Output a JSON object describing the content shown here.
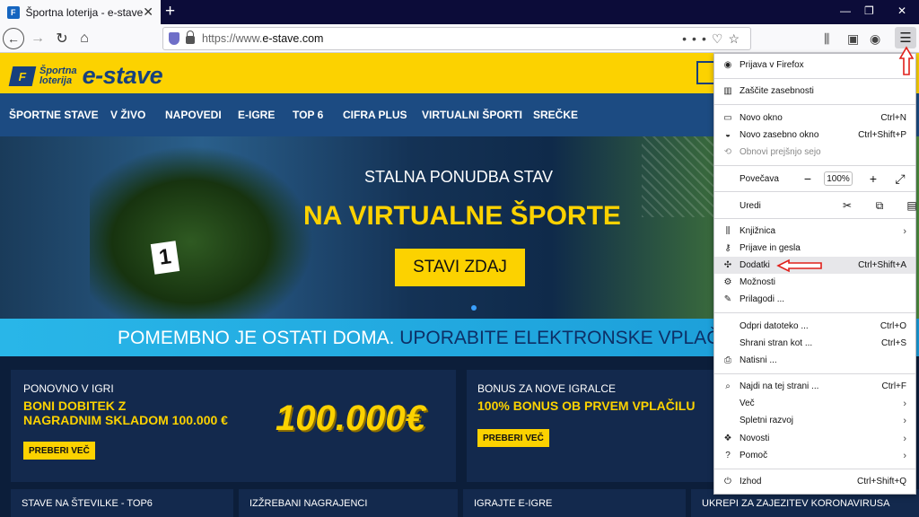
{
  "browser": {
    "tab_title": "Športna loterija - e-stave",
    "tab_favicon": "F",
    "new_tab": "+",
    "url_prefix": "https://www.",
    "url_domain": "e-stave.com",
    "win_min": "—",
    "win_max": "❐",
    "win_close": "✕"
  },
  "site": {
    "logo_small_line1": "Športna",
    "logo_small_line2": "loterija",
    "logo_big": "e-stave",
    "nav": [
      "ŠPORTNE STAVE",
      "V ŽIVO",
      "NAPOVEDI",
      "E-IGRE",
      "TOP 6",
      "CIFRA PLUS",
      "VIRTUALNI ŠPORTI",
      "SREČKE"
    ],
    "hero_sub": "STALNA PONUDBA STAV",
    "hero_title": "NA VIRTUALNE ŠPORTE",
    "hero_button": "STAVI ZDAJ",
    "hero_plate": "1",
    "banner_a": "POMEMBNO JE OSTATI DOMA.",
    "banner_b": " UPORABITE ELEKTRONSKE VPLAČI",
    "card1_kicker": "PONOVNO V IGRI",
    "card1_title_1": "BONI DOBITEK Z",
    "card1_title_2": "NAGRADNIM SKLADOM 100.000 €",
    "card1_button": "PREBERI VEČ",
    "card1_big": "100.000€",
    "card2_kicker": "BONUS ZA NOVE IGRALCE",
    "card2_title": "100% BONUS OB PRVEM VPLAČILU",
    "card2_button": "PREBERI VEČ",
    "bottom_cards": [
      "STAVE NA ŠTEVILKE - TOP6",
      "IZŽREBANI NAGRAJENCI",
      "IGRAJTE E-IGRE",
      "UKREPI ZA ZAJEZITEV KORONAVIRUSA"
    ]
  },
  "menu": {
    "sign_in": "Prijava v Firefox",
    "privacy": "Zaščite zasebnosti",
    "new_window": "Novo okno",
    "new_window_sc": "Ctrl+N",
    "private_window": "Novo zasebno okno",
    "private_window_sc": "Ctrl+Shift+P",
    "restore": "Obnovi prejšnjo sejo",
    "zoom": "Povečava",
    "zoom_minus": "−",
    "zoom_value": "100%",
    "zoom_plus": "+",
    "zoom_full": "⤢",
    "edit": "Uredi",
    "library": "Knjižnica",
    "logins": "Prijave in gesla",
    "addons": "Dodatki",
    "addons_sc": "Ctrl+Shift+A",
    "options": "Možnosti",
    "customize": "Prilagodi ...",
    "open_file": "Odpri datoteko ...",
    "open_file_sc": "Ctrl+O",
    "save_page": "Shrani stran kot ...",
    "save_page_sc": "Ctrl+S",
    "print": "Natisni ...",
    "find": "Najdi na tej strani ...",
    "find_sc": "Ctrl+F",
    "more": "Več",
    "webdev": "Spletni razvoj",
    "whatsnew": "Novosti",
    "help": "Pomoč",
    "quit": "Izhod",
    "quit_sc": "Ctrl+Shift+Q"
  },
  "colors": {
    "accent_yellow": "#fcd200",
    "site_blue": "#1c4b82",
    "annotation_red": "#e0201b"
  }
}
